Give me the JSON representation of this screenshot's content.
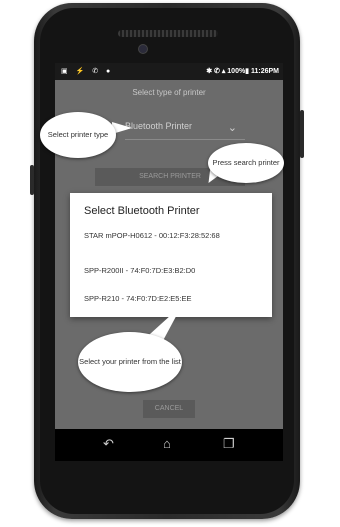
{
  "status_bar": {
    "left_icons": "▣ ⚡ ✆ ●",
    "right": "✱ ✆ ▴ 100%▮ 11:26PM"
  },
  "app": {
    "title": "Select type of printer",
    "dropdown_value": "Bluetooth Printer",
    "search_button": "SEARCH PRINTER",
    "cancel_button": "CANCEL"
  },
  "dialog": {
    "title": "Select Bluetooth Printer",
    "devices": [
      "STAR mPOP-H0612 - 00:12:F3:28:52:68",
      "SPP-R200II - 74:F0:7D:E3:B2:D0",
      "SPP-R210 - 74:F0:7D:E2:E5:EE"
    ]
  },
  "callouts": {
    "type": "Select printer type",
    "search": "Press search printer",
    "list": "Select your printer from the list"
  },
  "nav": {
    "back": "↶",
    "home": "⌂",
    "recents": "❐"
  },
  "colors": {
    "dim_overlay": "#6b6b6b",
    "phone": "#1a1a1a",
    "dialog": "#ffffff"
  }
}
